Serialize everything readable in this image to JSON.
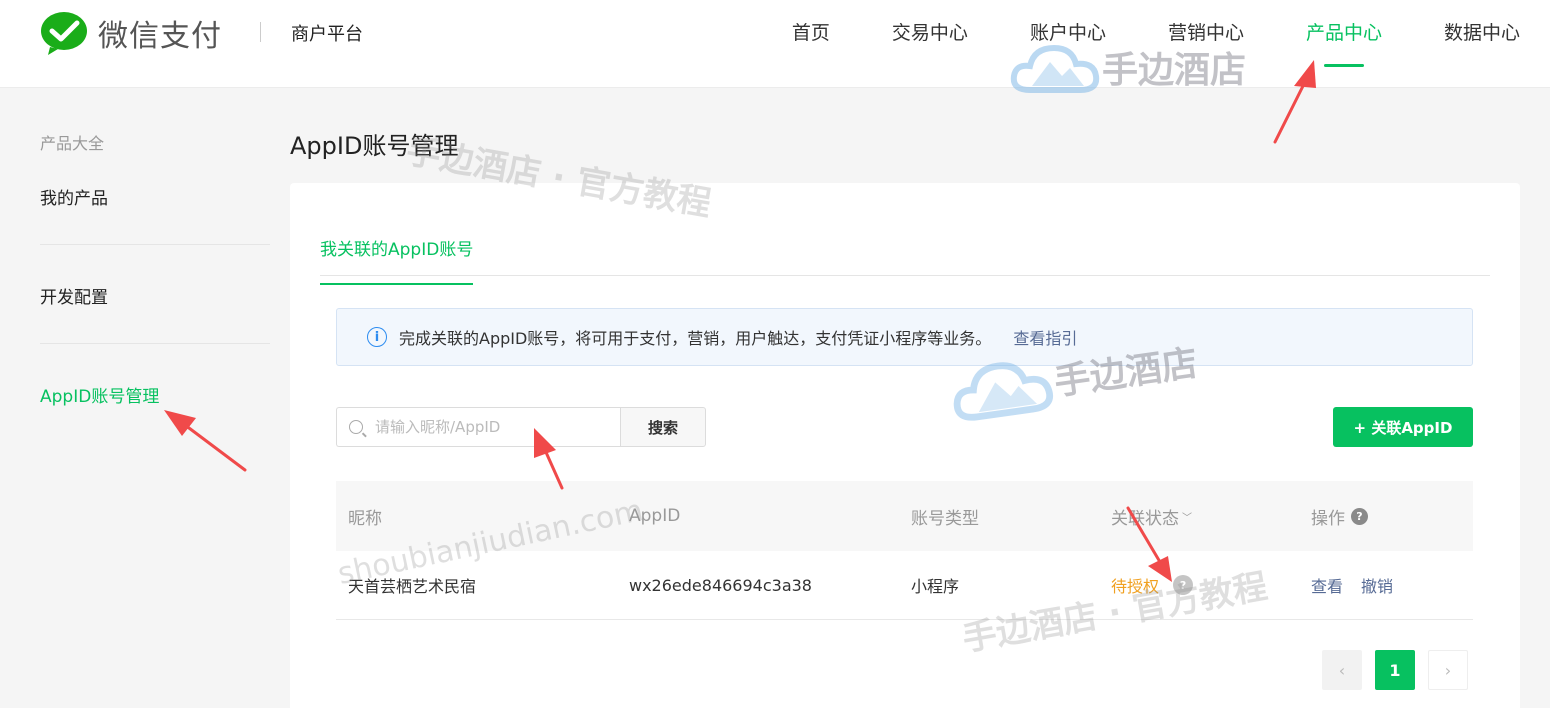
{
  "header": {
    "logo_text": "微信支付",
    "platform": "商户平台",
    "nav": [
      "首页",
      "交易中心",
      "账户中心",
      "营销中心",
      "产品中心",
      "数据中心"
    ],
    "active_nav_index": 4
  },
  "sidebar": {
    "group_title": "产品大全",
    "items": [
      "我的产品",
      "开发配置",
      "AppID账号管理"
    ],
    "active_index": 2
  },
  "main": {
    "title": "AppID账号管理",
    "tab": "我关联的AppID账号",
    "notice": {
      "text": "完成关联的AppID账号，将可用于支付，营销，用户触达，支付凭证小程序等业务。",
      "link": "查看指引"
    },
    "search": {
      "placeholder": "请输入昵称/AppID",
      "button": "搜索"
    },
    "add_button": "+ 关联AppID",
    "table": {
      "headers": [
        "昵称",
        "AppID",
        "账号类型",
        "关联状态",
        "操作"
      ],
      "rows": [
        {
          "nickname": "天首芸栖艺术民宿",
          "appid": "wx26ede846694c3a38",
          "type": "小程序",
          "status": "待授权",
          "ops": [
            "查看",
            "撤销"
          ]
        }
      ]
    },
    "pagination": {
      "current": "1"
    }
  },
  "watermarks": {
    "brand": "手边酒店",
    "tutorial": "手边酒店 · 官方教程",
    "domain": "shoubianjiudian.com"
  },
  "colors": {
    "accent": "#07c160",
    "link": "#576b95",
    "pending": "#f0a020",
    "info": "#2d8cf0",
    "annotation_arrow": "#f04a4a"
  }
}
